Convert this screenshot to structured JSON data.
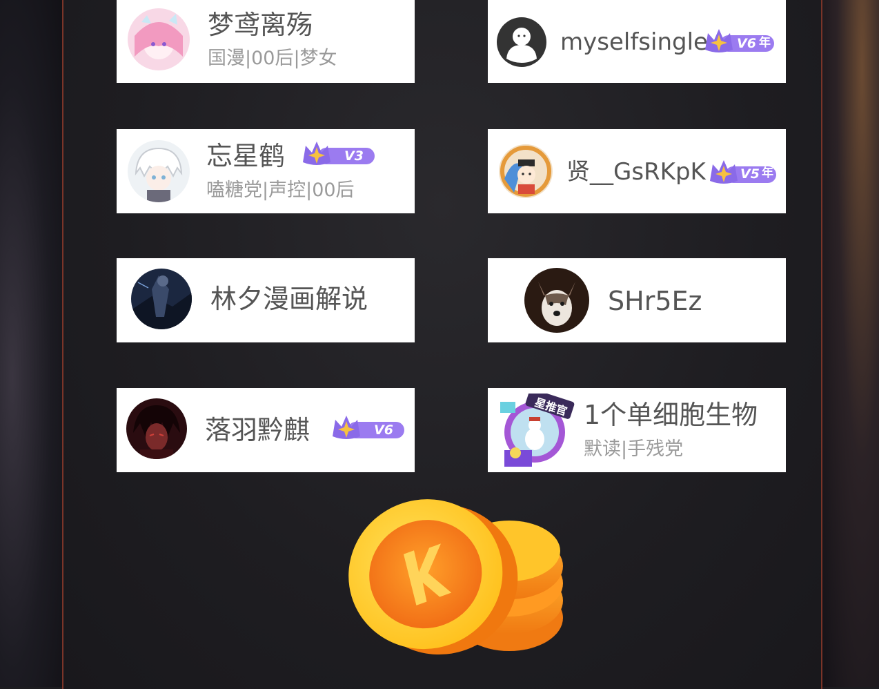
{
  "cards": [
    {
      "name": "梦鸢离殇",
      "tags": "国漫|00后|梦女"
    },
    {
      "name": "myselfsingle",
      "badge": "V6",
      "badge_suffix": "年"
    },
    {
      "name": "忘星鹤",
      "badge": "V3",
      "tags": "嗑糖党|声控|00后"
    },
    {
      "name": "贤__GsRKpK",
      "badge": "V5",
      "badge_suffix": "年"
    },
    {
      "name": "林夕漫画解说"
    },
    {
      "name": "SHr5Ez"
    },
    {
      "name": "落羽黔麒",
      "badge": "V6"
    },
    {
      "name": "1个单细胞生物",
      "tags": "默读|手残党",
      "avatar_frame_text": "星推官"
    }
  ],
  "colors": {
    "badge_purple": "#9b7bf0",
    "badge_star": "#f7c240",
    "coin_orange": "#f4911e",
    "coin_yellow": "#ffd23c",
    "panel_border": "#7a3428"
  },
  "icons": {
    "vip_crown": "crown-star-icon",
    "coin": "k-coin-icon"
  }
}
